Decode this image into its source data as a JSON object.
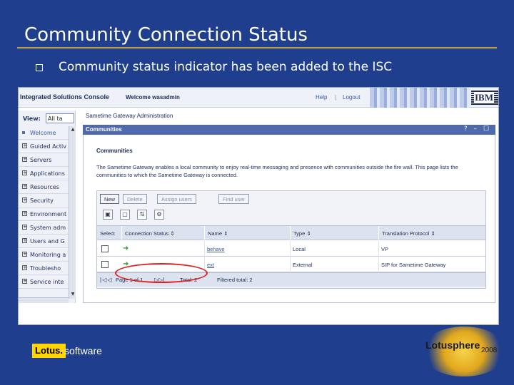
{
  "slide": {
    "title": "Community Connection Status",
    "bullet": "Community status indicator has been added to the ISC",
    "footer_left": "Lotus.",
    "footer_left_sub": "software",
    "footer_right": "Lotusphere",
    "footer_right_year": "2008",
    "colors": {
      "background": "#1f3e8e",
      "rule": "#c9a438",
      "lotus_yellow": "#ffd400"
    }
  },
  "console": {
    "product": "Integrated Solutions Console",
    "welcome": "Welcome wasadmin",
    "help": "Help",
    "separator": "|",
    "logout": "Logout",
    "brand": "IBM",
    "view_label": "View:",
    "view_value": "All ta",
    "nav": [
      {
        "label": "Welcome",
        "icon": "bullet-icon"
      },
      {
        "label": "Guided Activ",
        "icon": "expand-icon"
      },
      {
        "label": "Servers",
        "icon": "expand-icon"
      },
      {
        "label": "Applications",
        "icon": "expand-icon"
      },
      {
        "label": "Resources",
        "icon": "expand-icon"
      },
      {
        "label": "Security",
        "icon": "expand-icon"
      },
      {
        "label": "Environment",
        "icon": "expand-icon"
      },
      {
        "label": "System adm",
        "icon": "expand-icon"
      },
      {
        "label": "Users and G",
        "icon": "expand-icon"
      },
      {
        "label": "Monitoring a",
        "icon": "expand-icon"
      },
      {
        "label": "Troublesho",
        "icon": "expand-icon"
      },
      {
        "label": "Service inte",
        "icon": "expand-icon"
      }
    ],
    "breadcrumb": "Sametime Gateway Administration",
    "panel_title": "Communities",
    "panel_controls": "? – ☐",
    "section_title": "Communities",
    "description": "The Sametime Gateway enables a local community to enjoy real-time messaging and presence with communities outside the fire wall. This page lists the communities to which the Sametime Gateway is connected.",
    "buttons": {
      "new": "New",
      "delete": "Delete",
      "assign": "Assign users",
      "find": "Find user"
    },
    "columns": {
      "select": "Select",
      "status": "Connection Status",
      "name": "Name",
      "type": "Type",
      "protocol": "Translation Protocol",
      "sort_glyph": "⇕"
    },
    "rows": [
      {
        "name": "behave",
        "type": "Local",
        "protocol": "VP"
      },
      {
        "name": "ext",
        "type": "External",
        "protocol": "SIP for Sametime Gateway"
      }
    ],
    "footer": {
      "page": "Page 1 of 1",
      "total": "Total: 2",
      "filtered": "Filtered total: 2"
    }
  }
}
